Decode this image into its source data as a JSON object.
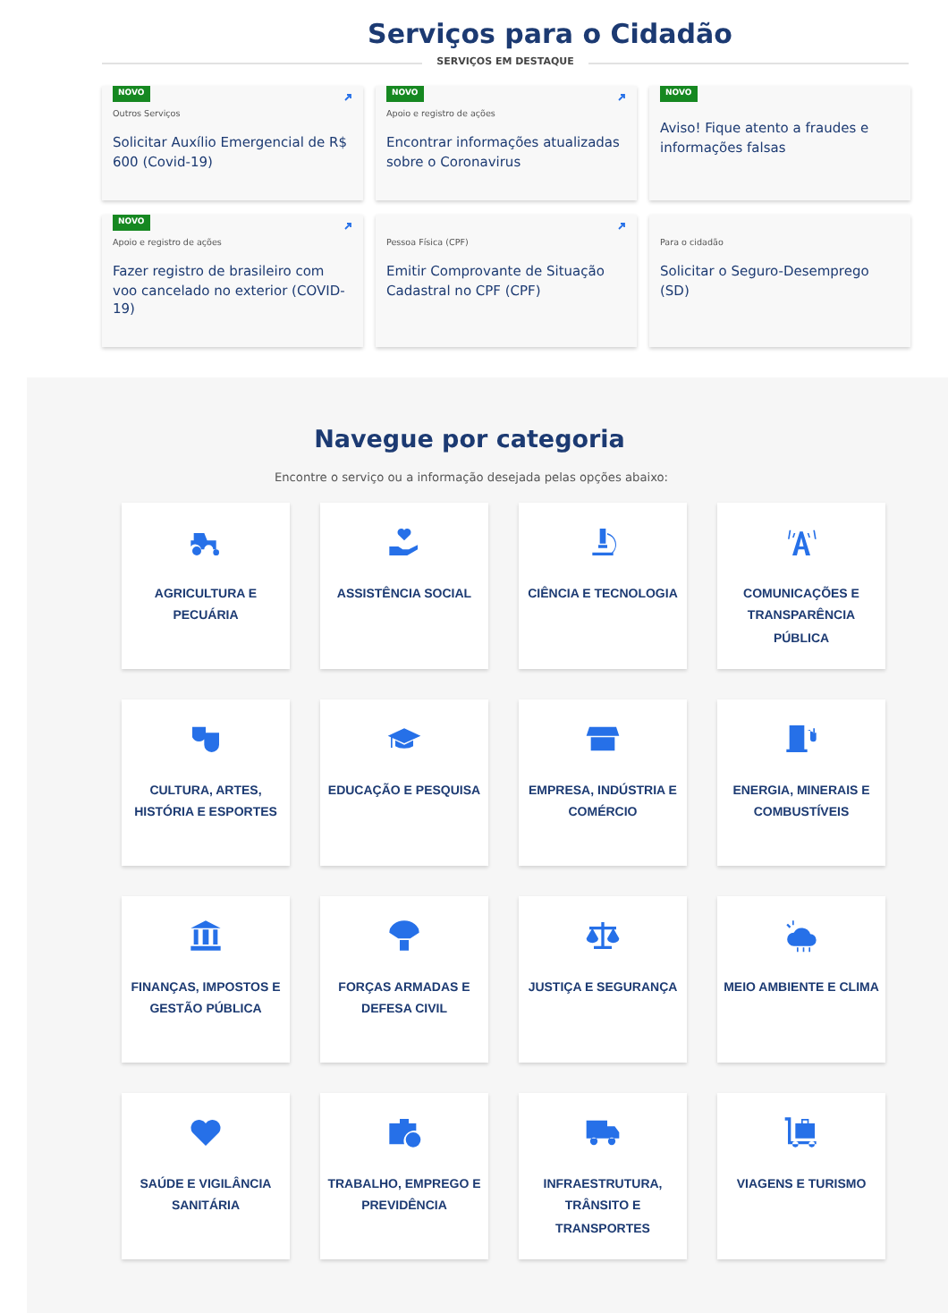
{
  "featured": {
    "title": "Serviços para o Cidadão",
    "subtitle": "SERVIÇOS EM DESTAQUE",
    "cards": [
      {
        "badge": "NOVO",
        "category": "Outros Serviços",
        "title": "Solicitar Auxílio Emergencial de R$ 600 (Covid-19)",
        "link_icon": true
      },
      {
        "badge": "NOVO",
        "category": "Apoio e registro de ações",
        "title": "Encontrar informações atualizadas sobre o Coronavirus",
        "link_icon": true
      },
      {
        "badge": "NOVO",
        "title": "Aviso! Fique atento a fraudes e informações falsas",
        "link_icon": false
      },
      {
        "badge": "NOVO",
        "category": "Apoio e registro de ações",
        "title": "Fazer registro de brasileiro com voo cancelado no exterior (COVID-19)",
        "link_icon": true
      },
      {
        "category": "Pessoa Física (CPF)",
        "title": "Emitir Comprovante de Situação Cadastral no CPF (CPF)",
        "link_icon": true
      },
      {
        "category": "Para o cidadão",
        "title": "Solicitar o Seguro-Desemprego (SD)",
        "link_icon": false
      }
    ]
  },
  "categories": {
    "title": "Navegue por categoria",
    "subtitle": "Encontre o serviço ou a informação desejada pelas opções abaixo:",
    "items": [
      {
        "label": "AGRICULTURA E PECUÁRIA"
      },
      {
        "label": "ASSISTÊNCIA SOCIAL"
      },
      {
        "label": "CIÊNCIA E TECNOLOGIA"
      },
      {
        "label": "COMUNICAÇÕES E TRANSPARÊNCIA PÚBLICA"
      },
      {
        "label": "CULTURA, ARTES, HISTÓRIA E ESPORTES"
      },
      {
        "label": "EDUCAÇÃO E PESQUISA"
      },
      {
        "label": "EMPRESA, INDÚSTRIA E COMÉRCIO"
      },
      {
        "label": "ENERGIA, MINERAIS E COMBUSTÍVEIS"
      },
      {
        "label": "FINANÇAS, IMPOSTOS E GESTÃO PÚBLICA"
      },
      {
        "label": "FORÇAS ARMADAS E DEFESA CIVIL"
      },
      {
        "label": "JUSTIÇA E SEGURANÇA"
      },
      {
        "label": "MEIO AMBIENTE E CLIMA"
      },
      {
        "label": "SAÚDE E VIGILÂNCIA SANITÁRIA"
      },
      {
        "label": "TRABALHO, EMPREGO E PREVIDÊNCIA"
      },
      {
        "label": "INFRAESTRUTURA, TRÂNSITO E TRANSPORTES"
      },
      {
        "label": "VIAGENS E TURISMO"
      }
    ]
  }
}
